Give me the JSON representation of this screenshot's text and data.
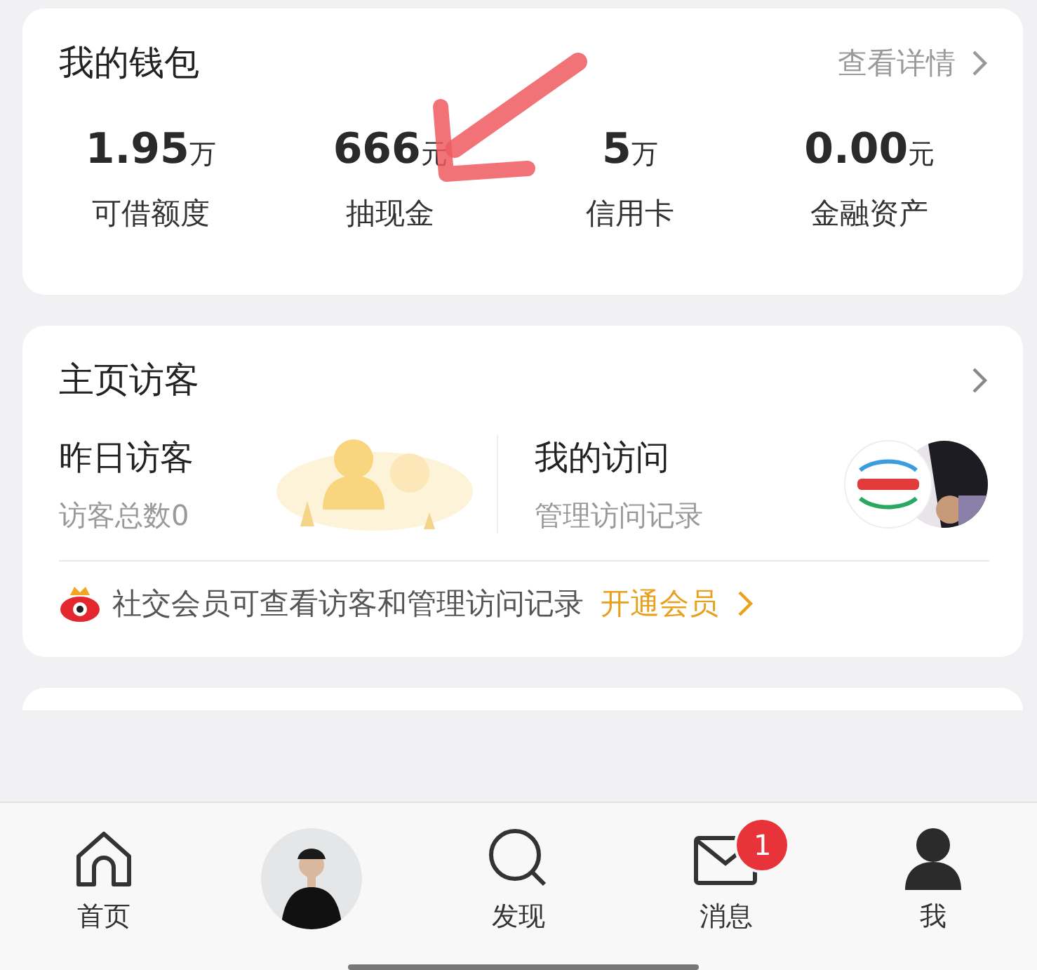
{
  "wallet": {
    "title": "我的钱包",
    "link": "查看详情",
    "annotation": {
      "kind": "arrow"
    },
    "stats": [
      {
        "value": "1.95",
        "unit": "万",
        "label": "可借额度"
      },
      {
        "value": "666",
        "unit": "元",
        "label": "抽现金"
      },
      {
        "value": "5",
        "unit": "万",
        "label": "信用卡"
      },
      {
        "value": "0.00",
        "unit": "元",
        "label": "金融资产"
      }
    ]
  },
  "visitors": {
    "title": "主页访客",
    "yesterday": {
      "title": "昨日访客",
      "sub": "访客总数0"
    },
    "mine": {
      "title": "我的访问",
      "sub": "管理访问记录"
    },
    "promo": {
      "text": "社交会员可查看访客和管理访问记录",
      "action": "开通会员"
    }
  },
  "tabs": [
    {
      "kind": "home",
      "label": "首页"
    },
    {
      "kind": "avatar"
    },
    {
      "kind": "discover",
      "label": "发现"
    },
    {
      "kind": "message",
      "label": "消息",
      "badge": "1"
    },
    {
      "kind": "me",
      "label": "我"
    }
  ]
}
